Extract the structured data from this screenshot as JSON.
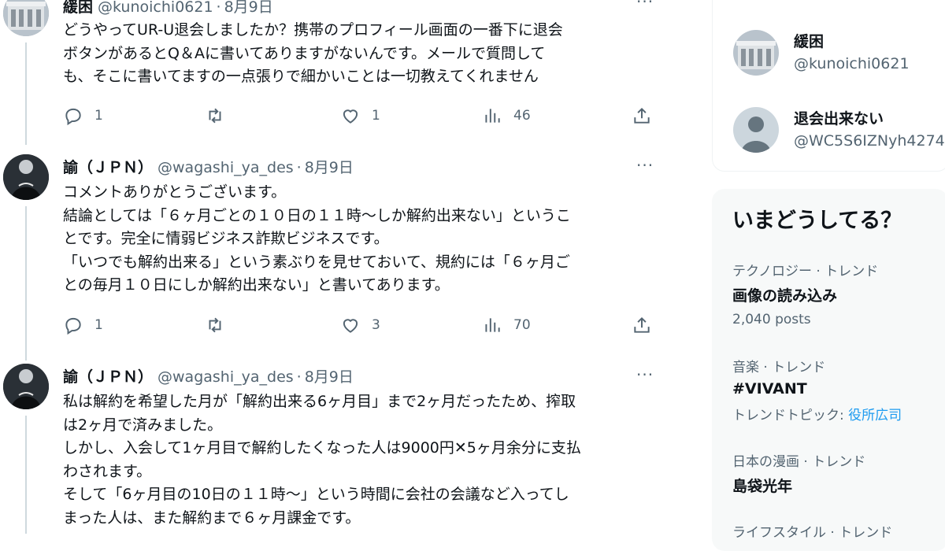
{
  "tweets": [
    {
      "name": "緩困",
      "handle": "@kunoichi0621",
      "date": "8月9日",
      "text": "どうやってUR-U退会しましたか？携帯のプロフィール画面の一番下に退会\nボタンがあるとQ＆Aに書いてありますがないんです。メールで質問して\nも、そこに書いてますの一点張りで細かいことは一切教えてくれません",
      "replies": "1",
      "retweets": "",
      "likes": "1",
      "views": "46"
    },
    {
      "name": "諭（ＪＰＮ）",
      "handle": "@wagashi_ya_des",
      "date": "8月9日",
      "text": "コメントありがとうございます。\n結論としては「６ヶ月ごとの１０日の１１時〜しか解約出来ない」というこ\nとです。完全に情弱ビジネス詐欺ビジネスです。\n「いつでも解約出来る」という素ぶりを見せておいて、規約には「６ヶ月ご\nとの毎月１０日にしか解約出来ない」と書いてあります。",
      "replies": "1",
      "retweets": "",
      "likes": "3",
      "views": "70"
    },
    {
      "name": "諭（ＪＰＮ）",
      "handle": "@wagashi_ya_des",
      "date": "8月9日",
      "text": "私は解約を希望した月が「解約出来る6ヶ月目」まで2ヶ月だったため、搾取\nは2ヶ月で済みました。\nしかし、入会して1ヶ月目で解約したくなった人は9000円✕5ヶ月余分に支払\nわされます。\nそして「6ヶ月目の10日の１１時〜」という時間に会社の会議など入ってし\nまった人は、また解約まで６ヶ月課金です。"
    }
  ],
  "more_label": "···",
  "sidebar": {
    "suggestions": [
      {
        "name": "緩困",
        "handle": "@kunoichi0621"
      },
      {
        "name": "退会出来ない",
        "handle": "@WC5S6IZNyh4274"
      }
    ],
    "trends_title": "いまどうしてる？",
    "trends": [
      {
        "category": "テクノロジー · トレンド",
        "title": "画像の読み込み",
        "sub": "2,040 posts"
      },
      {
        "category": "音楽 · トレンド",
        "title": "#VIVANT",
        "sub_prefix": "トレンドトピック: ",
        "sub_link": "役所広司"
      },
      {
        "category": "日本の漫画 · トレンド",
        "title": "島袋光年"
      },
      {
        "category": "ライフスタイル · トレンド"
      }
    ]
  },
  "colors": {
    "text": "#0f1419",
    "secondary": "#536471",
    "link": "#1d9bf0",
    "panel": "#f7f9f9"
  },
  "icons": [
    "reply-icon",
    "retweet-icon",
    "like-icon",
    "views-icon",
    "share-icon",
    "more-icon"
  ]
}
